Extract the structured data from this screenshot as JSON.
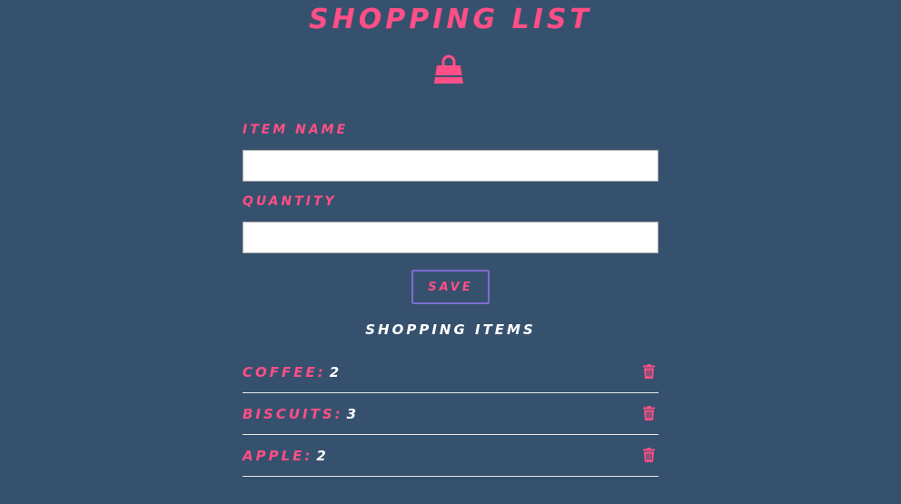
{
  "app": {
    "title": "Shopping List",
    "accent_color": "#ff4f86",
    "background_color": "#36516e",
    "button_border_color": "#7f6bd1",
    "header_icon": "shopping-bag-icon"
  },
  "form": {
    "item_name_label": "Item Name",
    "item_name_value": "",
    "quantity_label": "Quantity",
    "quantity_value": "",
    "save_label": "Save"
  },
  "list": {
    "heading": "Shopping Items",
    "delete_icon": "trash-icon",
    "items": [
      {
        "name": "Coffee:",
        "quantity": "2"
      },
      {
        "name": "Biscuits:",
        "quantity": "3"
      },
      {
        "name": "Apple:",
        "quantity": "2"
      }
    ]
  }
}
